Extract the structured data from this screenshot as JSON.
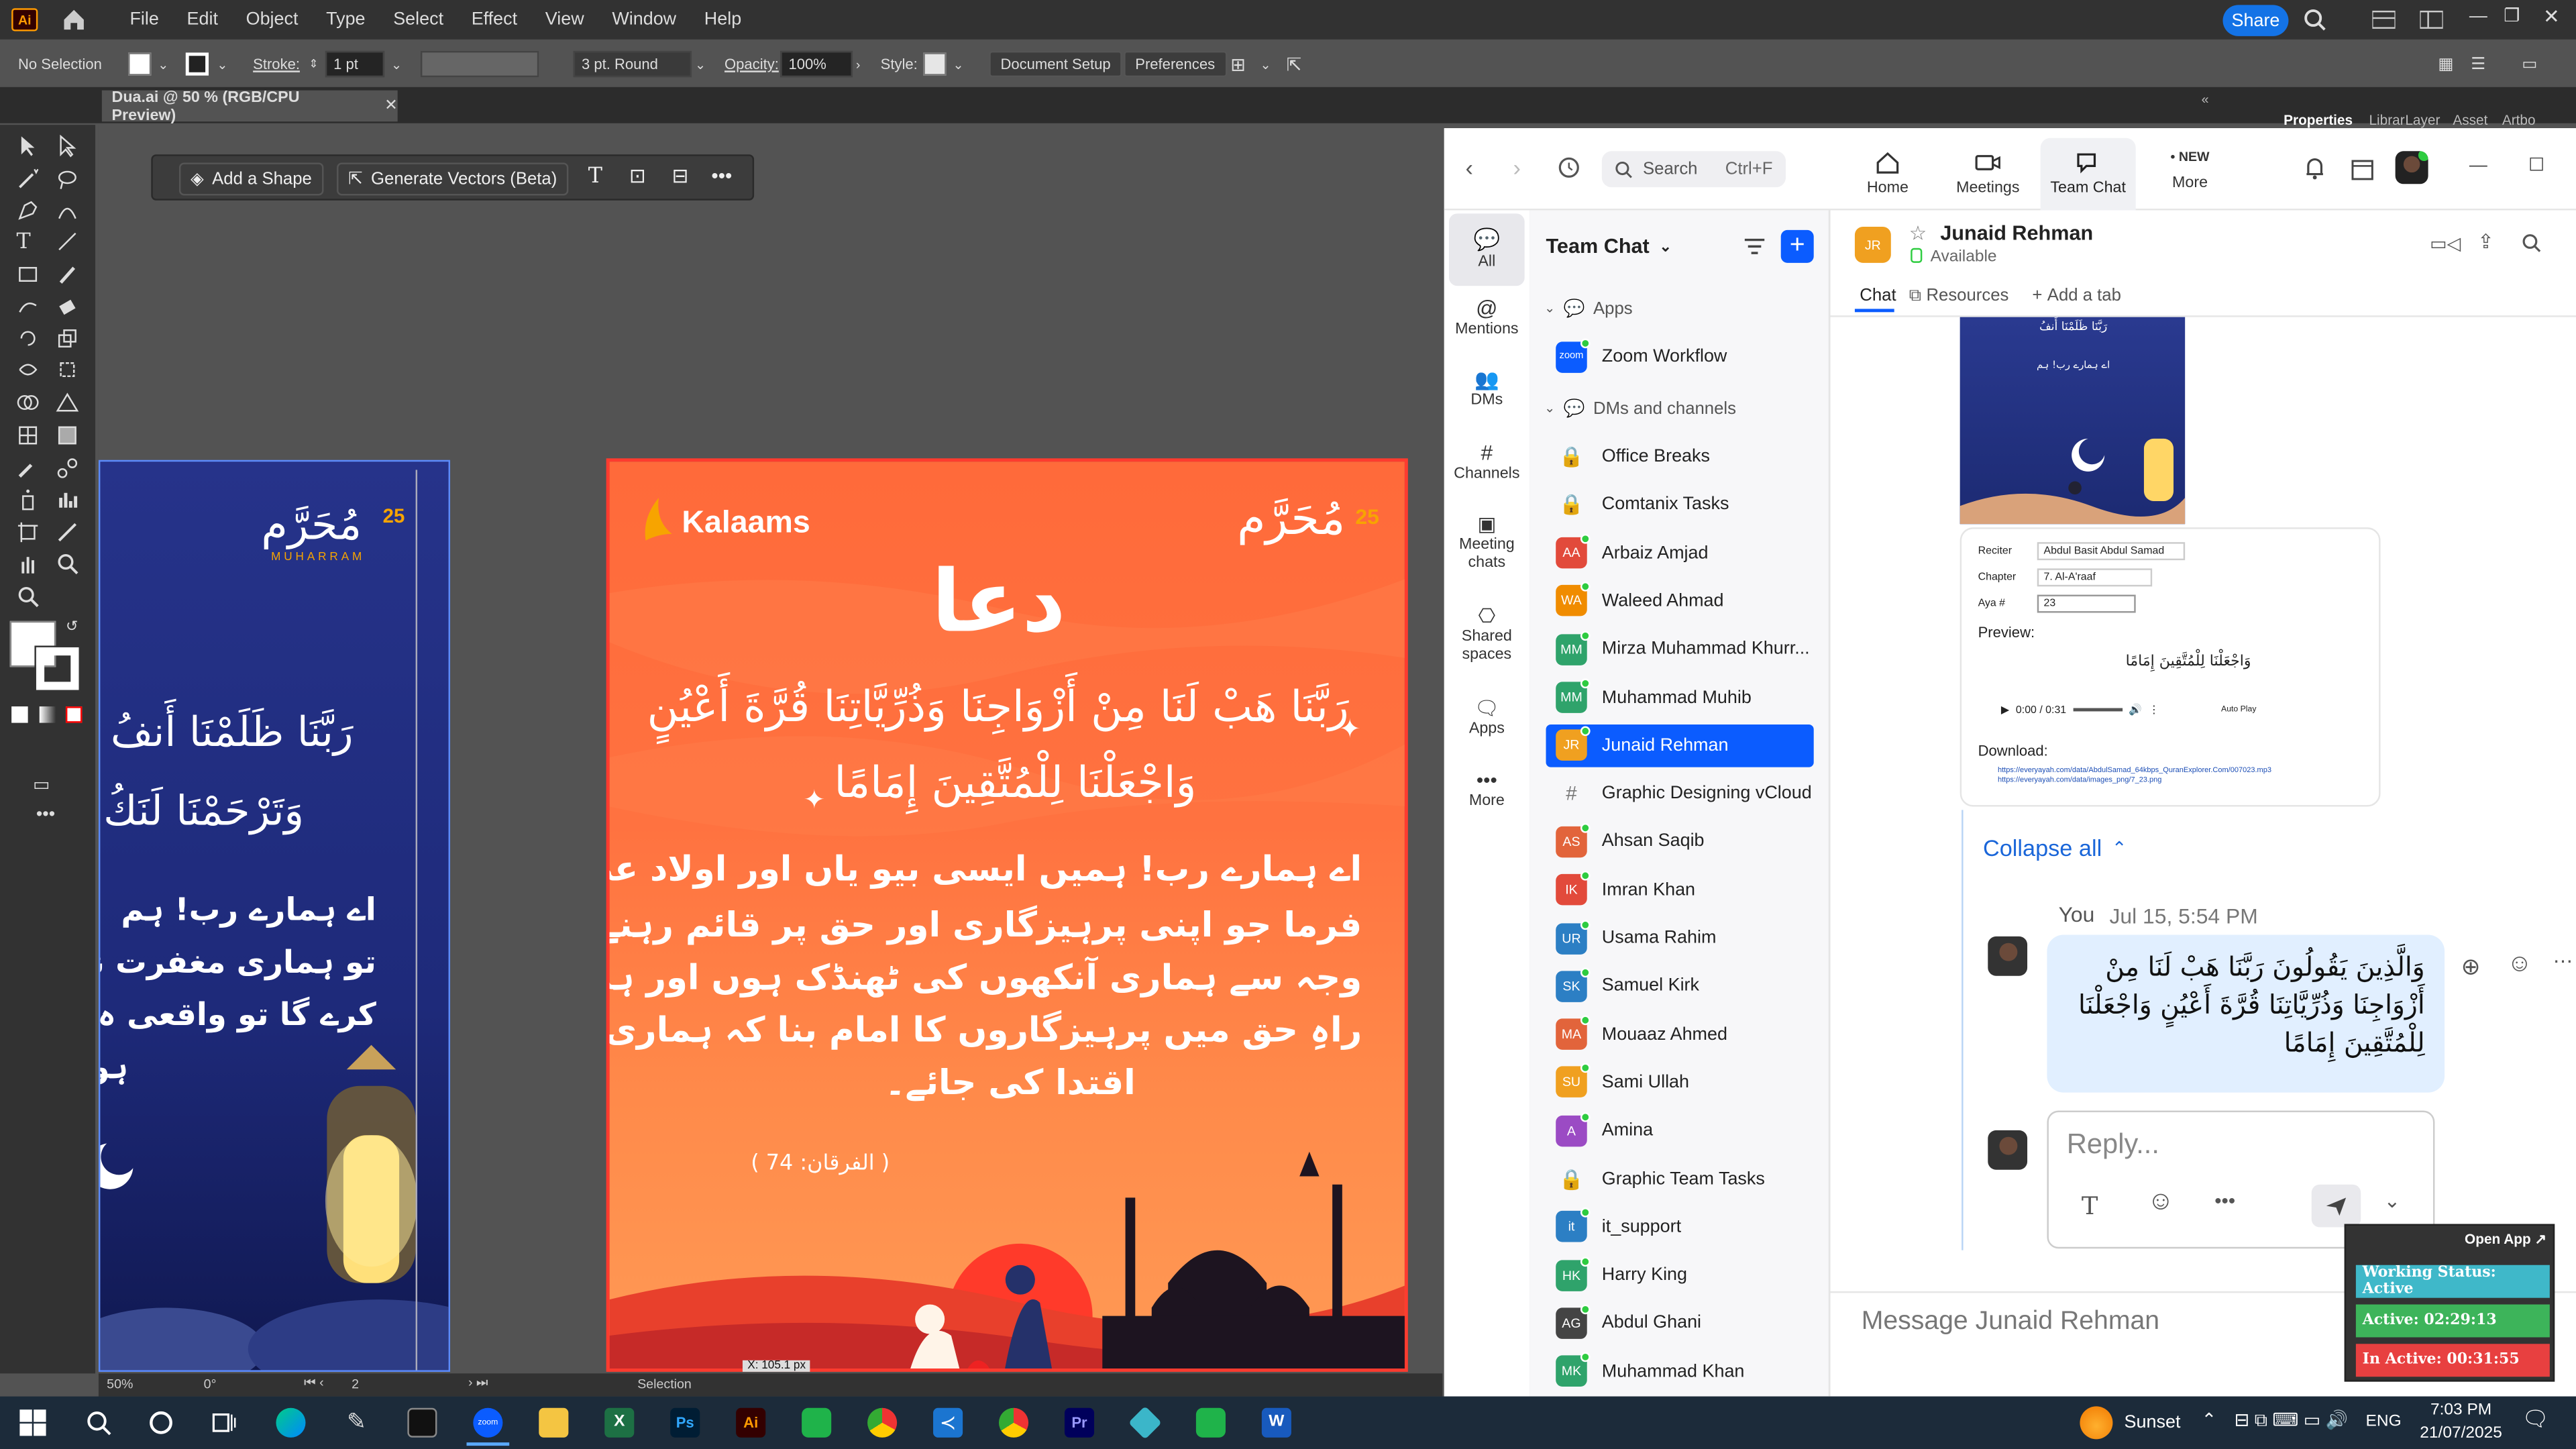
{
  "ai": {
    "menus": [
      "File",
      "Edit",
      "Object",
      "Type",
      "Select",
      "Effect",
      "View",
      "Window",
      "Help"
    ],
    "share": "Share",
    "control": {
      "selection": "No Selection",
      "stroke_label": "Stroke:",
      "stroke_value": "1 pt",
      "brush": "3 pt. Round",
      "opacity_label": "Opacity:",
      "opacity_value": "100%",
      "style_label": "Style:",
      "doc_setup": "Document Setup",
      "preferences": "Preferences"
    },
    "doc_tab": "Dua.ai @ 50 % (RGB/CPU Preview)",
    "panel_tabs": [
      "Properties",
      "Librar",
      "Layer",
      "Asset",
      "Artbo"
    ],
    "context_bar": {
      "add_shape": "Add a Shape",
      "generate": "Generate Vectors (Beta)"
    },
    "status": {
      "zoom": "50%",
      "rotate": "0°",
      "page": "2",
      "mode": "Selection",
      "tooltip": "X: 105.1 px"
    }
  },
  "artboard": {
    "brand": "Kalaams",
    "muharram": "مُحَرَّم",
    "muharram_num": "25",
    "muharram_en": "MUHARRAM",
    "title": "دعا",
    "verse1": "رَبَّنَا هَبْ لَنَا مِنْ أَزْوَاجِنَا وَذُرِّيَّاتِنَا قُرَّةَ أَعْيُنٍ",
    "verse2": "وَاجْعَلْنَا لِلْمُتَّقِينَ إِمَامًا",
    "urdu": [
      "اے ہمارے رب! ہمیں ایسی بیو یاں اور اولاد عطا",
      "فرما جو اپنی پرہیزگاری اور حق پر قائم رہنے کی",
      "وجہ سے ہماری آنکھوں کی ٹھنڈک ہوں اور ہمیں",
      "راہِ حق میں پرہیزگاروں کا امام بنا کہ ہماری",
      "اقتدا کی جائے۔"
    ],
    "ref": "( الفرقان: 74 )",
    "left_verse1": "رَبَّنَا ظَلَمْنَا أَنفُ",
    "left_verse2": "وَتَرْحَمْنَا لَنَكُ",
    "left_urdu": [
      "اے ہمارے رب! ہم",
      "تو ہماری مغفرت نہ",
      "کرے گا تو واقعی ہ",
      "ہو"
    ]
  },
  "zoom": {
    "search": "Search",
    "search_shortcut": "Ctrl+F",
    "nav": [
      {
        "label": "Home"
      },
      {
        "label": "Meetings"
      },
      {
        "label": "Team Chat"
      },
      {
        "label": "More",
        "badge": "NEW"
      }
    ],
    "side": [
      "All",
      "Mentions",
      "DMs",
      "Channels",
      "Meeting chats",
      "Shared spaces",
      "Apps",
      "More"
    ],
    "list_title": "Team Chat",
    "section_apps": "Apps",
    "zoom_workflow": "Zoom Workflow",
    "section_dms": "DMs and channels",
    "channels": [
      {
        "name": "Office Breaks",
        "type": "lock"
      },
      {
        "name": "Comtanix Tasks",
        "type": "lock"
      },
      {
        "name": "Arbaiz Amjad",
        "initials": "AA",
        "color": "#e24a3b"
      },
      {
        "name": "Waleed Ahmad",
        "initials": "WA",
        "color": "#f08c00"
      },
      {
        "name": "Mirza Muhammad Khurr...",
        "initials": "MM",
        "color": "#2fa36b"
      },
      {
        "name": "Muhammad Muhib",
        "initials": "MM",
        "color": "#2fa36b"
      },
      {
        "name": "Junaid Rehman",
        "initials": "JR",
        "color": "#f0a020",
        "active": true
      },
      {
        "name": "Graphic Designing vCloud",
        "type": "hash"
      },
      {
        "name": "Ahsan Saqib",
        "initials": "AS",
        "color": "#e2643b"
      },
      {
        "name": "Imran Khan",
        "initials": "IK",
        "color": "#e24a3b"
      },
      {
        "name": "Usama Rahim",
        "initials": "UR",
        "color": "#2c7fc4"
      },
      {
        "name": "Samuel Kirk",
        "initials": "SK",
        "color": "#2c7fc4"
      },
      {
        "name": "Mouaaz Ahmed",
        "initials": "MA",
        "color": "#e2643b"
      },
      {
        "name": "Sami Ullah",
        "initials": "SU",
        "color": "#f0a020"
      },
      {
        "name": "Amina",
        "initials": "A",
        "color": "#9b4bc4"
      },
      {
        "name": "Graphic Team Tasks",
        "type": "lock"
      },
      {
        "name": "it_support",
        "initials": "it",
        "color": "#2c7fc4"
      },
      {
        "name": "Harry King",
        "initials": "HK",
        "color": "#2fa36b"
      },
      {
        "name": "Abdul Ghani",
        "initials": "AG",
        "color": "#444"
      },
      {
        "name": "Muhammad Khan",
        "initials": "MK",
        "color": "#2fa36b"
      }
    ],
    "chat": {
      "name": "Junaid Rehman",
      "initials": "JR",
      "status": "Available",
      "tabs": [
        "Chat",
        "Resources",
        "Add a tab"
      ],
      "preview": {
        "reciter_label": "Reciter",
        "reciter": "Abdul Basit Abdul Samad",
        "chapter_label": "Chapter",
        "chapter": "7. Al-A'raaf",
        "aya_label": "Aya #",
        "aya": "23",
        "preview_label": "Preview:",
        "time": "0:00 / 0:31",
        "autoplay": "Auto Play",
        "download": "Download:",
        "link1": "https://everyayah.com/data/AbdulSamad_64kbps_QuranExplorer.Com/007023.mp3",
        "link2": "https://everyayah.com/data/images_png/7_23.png"
      },
      "collapse": "Collapse all",
      "you": "You",
      "time": "Jul 15, 5:54 PM",
      "message": "وَالَّذِينَ يَقُولُونَ رَبَّنَا هَبْ لَنَا مِنْ أَزْوَاجِنَا وَذُرِّيَّاتِنَا قُرَّةَ أَعْيُنٍ وَاجْعَلْنَا لِلْمُتَّقِينَ إِمَامًا",
      "reply": "Reply...",
      "composer": "Message Junaid Rehman"
    }
  },
  "work": {
    "open_app": "Open App ↗",
    "status": "Working Status: Active",
    "active": "Active: 02:29:13",
    "inactive": "In Active: 00:31:55"
  },
  "taskbar": {
    "weather": "Sunset",
    "lang": "ENG",
    "time": "7:03 PM",
    "date": "21/07/2025"
  }
}
